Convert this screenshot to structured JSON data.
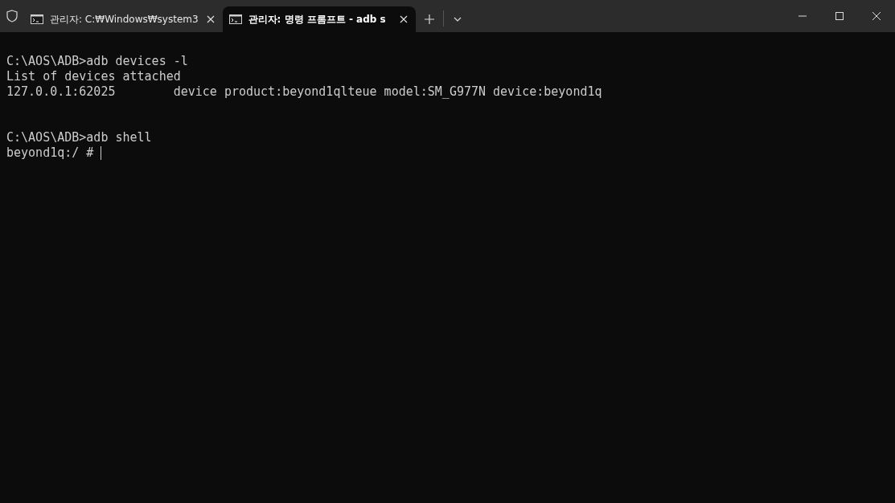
{
  "tabs": [
    {
      "title": "관리자: C:₩Windows₩system3",
      "selected": false
    },
    {
      "title": "관리자: 명령 프롬프트 - adb  s",
      "selected": true
    }
  ],
  "terminal": {
    "lines": [
      {
        "kind": "text",
        "text": "C:\\AOS\\ADB>adb devices -l"
      },
      {
        "kind": "text",
        "text": "List of devices attached"
      },
      {
        "kind": "text",
        "text": "127.0.0.1:62025        device product:beyond1qlteue model:SM_G977N device:beyond1q"
      },
      {
        "kind": "blank"
      },
      {
        "kind": "blank"
      },
      {
        "kind": "text",
        "text": "C:\\AOS\\ADB>adb shell"
      },
      {
        "kind": "prompt",
        "text": "beyond1q:/ # "
      }
    ]
  }
}
